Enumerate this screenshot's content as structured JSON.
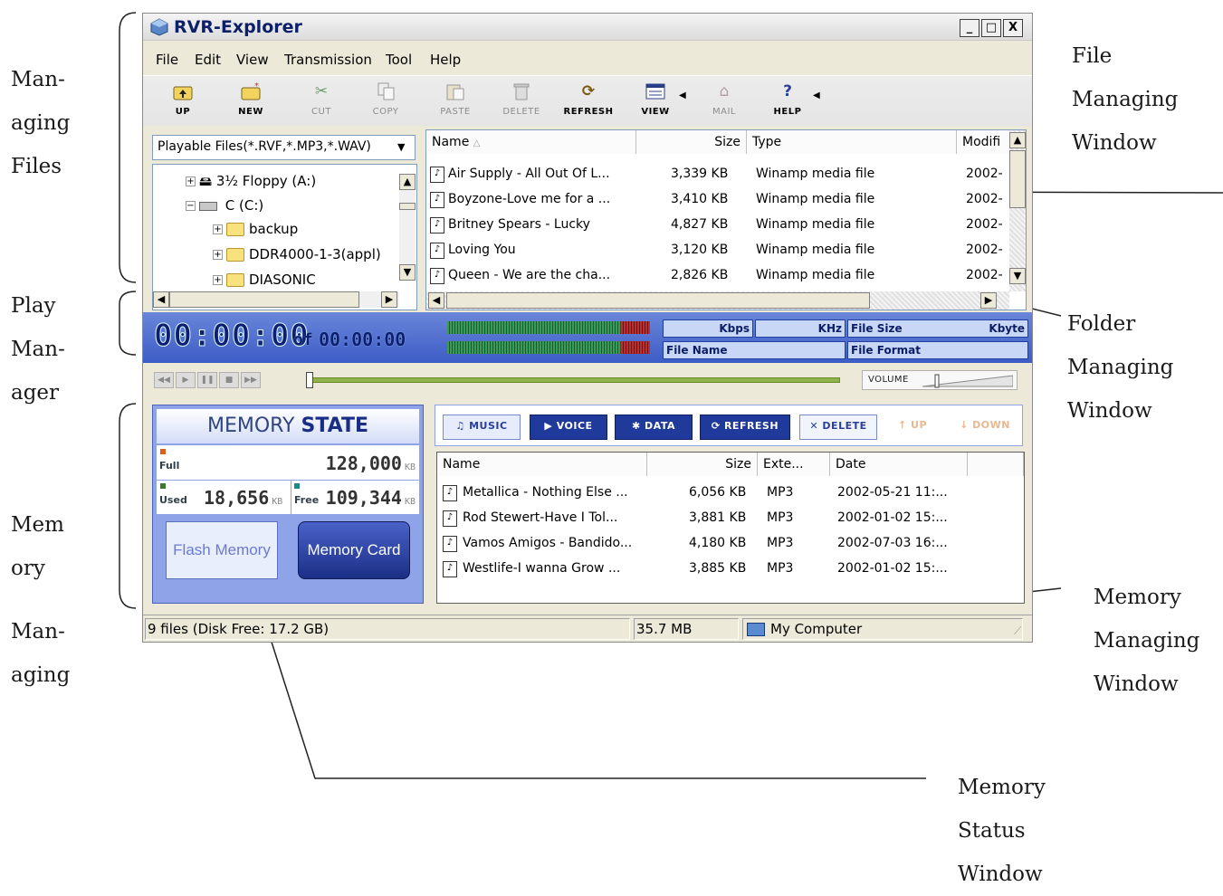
{
  "annotations": {
    "managing_files": [
      "Man-",
      "aging",
      "Files"
    ],
    "play_manager": [
      "Play",
      "Man-",
      "ager"
    ],
    "memory_managing": [
      "Mem",
      "ory",
      "Man-",
      "aging"
    ],
    "file_managing_window": [
      "File",
      "Managing",
      "Window"
    ],
    "folder_managing_window": [
      "Folder",
      "Managing",
      "Window"
    ],
    "memory_managing_window": [
      "Memory",
      "Managing",
      "Window"
    ],
    "memory_status_window": [
      "Memory",
      "Status",
      "Window"
    ]
  },
  "window": {
    "title": "RVR-Explorer",
    "min": "_",
    "max": "□",
    "close": "X"
  },
  "menu": [
    "File",
    "Edit",
    "View",
    "Transmission",
    "Tool",
    "Help"
  ],
  "toolbar": {
    "up": "UP",
    "new": "NEW",
    "cut": "CUT",
    "copy": "COPY",
    "paste": "PASTE",
    "delete": "DELETE",
    "refresh": "REFRESH",
    "view": "VIEW",
    "mail": "MAIL",
    "help": "HELP"
  },
  "filter": {
    "value": "Playable Files(*.RVF,*.MP3,*.WAV)"
  },
  "tree": [
    {
      "label": "3½ Floppy (A:)"
    },
    {
      "label": "C (C:)"
    },
    {
      "label": "backup"
    },
    {
      "label": "DDR4000-1-3(appl)"
    },
    {
      "label": "DIASONIC"
    }
  ],
  "file_list": {
    "columns": [
      "Name",
      "Size",
      "Type",
      "Modifi"
    ],
    "rows": [
      {
        "name": "Air Supply - All Out Of L...",
        "size": "3,339 KB",
        "type": "Winamp media file",
        "modified": "2002-"
      },
      {
        "name": "Boyzone-Love me for a ...",
        "size": "3,410 KB",
        "type": "Winamp media file",
        "modified": "2002-"
      },
      {
        "name": "Britney Spears - Lucky",
        "size": "4,827 KB",
        "type": "Winamp media file",
        "modified": "2002-"
      },
      {
        "name": "Loving You",
        "size": "3,120 KB",
        "type": "Winamp media file",
        "modified": "2002-"
      },
      {
        "name": "Queen - We are the cha...",
        "size": "2,826 KB",
        "type": "Winamp media file",
        "modified": "2002-"
      }
    ]
  },
  "player": {
    "time": "00:00:00",
    "of": "of",
    "total": "00:00:00",
    "kbps": "Kbps",
    "khz": "KHz",
    "file_size": "File Size",
    "kbyte": "Kbyte",
    "file_name": "File Name",
    "file_format": "File Format",
    "volume": "VOLUME"
  },
  "memory_state": {
    "title_a": "MEMORY",
    "title_b": "STATE",
    "full_label": "Full",
    "full_value": "128,000",
    "used_label": "Used",
    "used_value": "18,656",
    "free_label": "Free",
    "free_value": "109,344",
    "unit": "KB",
    "flash_memory": "Flash Memory",
    "memory_card": "Memory Card"
  },
  "memory_tabs": {
    "music": "MUSIC",
    "voice": "VOICE",
    "data": "DATA",
    "refresh": "REFRESH",
    "delete": "DELETE",
    "up": "UP",
    "down": "DOWN"
  },
  "memory_list": {
    "columns": [
      "Name",
      "Size",
      "Exte...",
      "Date"
    ],
    "rows": [
      {
        "name": "Metallica - Nothing Else ...",
        "size": "6,056 KB",
        "ext": "MP3",
        "date": "2002-05-21 11:..."
      },
      {
        "name": "Rod Stewert-Have I Tol...",
        "size": "3,881 KB",
        "ext": "MP3",
        "date": "2002-01-02 15:..."
      },
      {
        "name": "Vamos Amigos - Bandido...",
        "size": "4,180 KB",
        "ext": "MP3",
        "date": "2002-07-03 16:..."
      },
      {
        "name": "Westlife-I wanna Grow ...",
        "size": "3,885 KB",
        "ext": "MP3",
        "date": "2002-01-02 15:..."
      }
    ]
  },
  "status_bar": {
    "files": "9 files (Disk Free: 17.2 GB)",
    "size": "35.7 MB",
    "location": "My Computer"
  },
  "colors": {
    "title_text": "#0d1f66",
    "play_strip": "#4a68cc",
    "memory_panel": "#8ea3e8",
    "vu_red": "#b83030",
    "vu_green": "#3a9a5a"
  }
}
